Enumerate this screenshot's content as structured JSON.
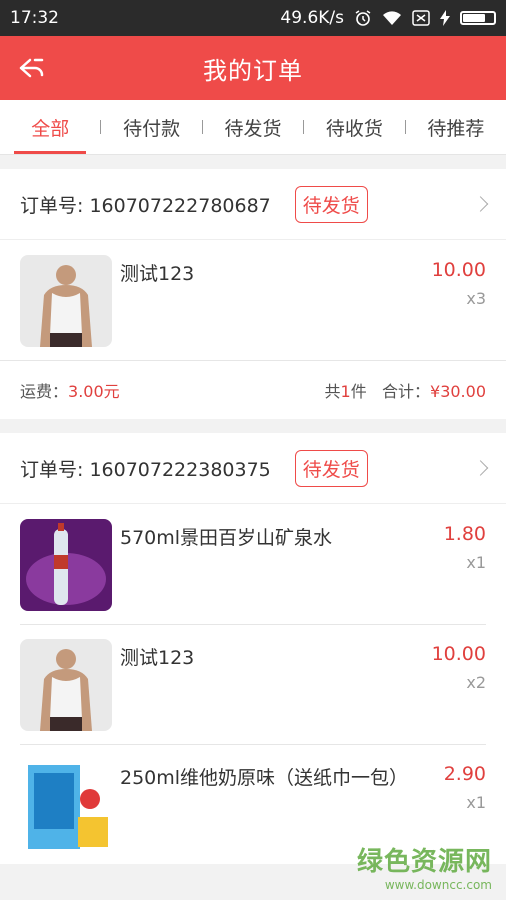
{
  "status_bar": {
    "time": "17:32",
    "net_speed": "49.6K/s"
  },
  "header": {
    "title": "我的订单"
  },
  "tabs": [
    {
      "label": "全部",
      "active": true
    },
    {
      "label": "待付款"
    },
    {
      "label": "待发货"
    },
    {
      "label": "待收货"
    },
    {
      "label": "待推荐"
    }
  ],
  "orders": [
    {
      "order_no": "订单号: 160707222780687",
      "status": "待发货",
      "items": [
        {
          "name": "测试123",
          "price": "10.00",
          "qty": "x3",
          "thumb_icon": "tank-top-model-photo"
        }
      ],
      "footer": {
        "shipping_label": "运费：",
        "shipping_value": "3.00元",
        "count_prefix": "共",
        "count": "1",
        "count_suffix": "件",
        "total_label": "合计：",
        "total_value": "¥30.00"
      }
    },
    {
      "order_no": "订单号: 160707222380375",
      "status": "待发货",
      "items": [
        {
          "name": "570ml景田百岁山矿泉水",
          "price": "1.80",
          "qty": "x1",
          "thumb_icon": "water-bottle-photo"
        },
        {
          "name": "测试123",
          "price": "10.00",
          "qty": "x2",
          "thumb_icon": "tank-top-model-photo"
        },
        {
          "name": "250ml维他奶原味（送纸巾一包）",
          "price": "2.90",
          "qty": "x1",
          "thumb_icon": "soy-milk-carton-photo"
        }
      ]
    }
  ],
  "watermark": {
    "main": "绿色资源网",
    "sub": "www.downcc.com"
  },
  "colors": {
    "accent": "#ef4b49",
    "price": "#e0403e",
    "statusbar": "#2b2b2b"
  }
}
